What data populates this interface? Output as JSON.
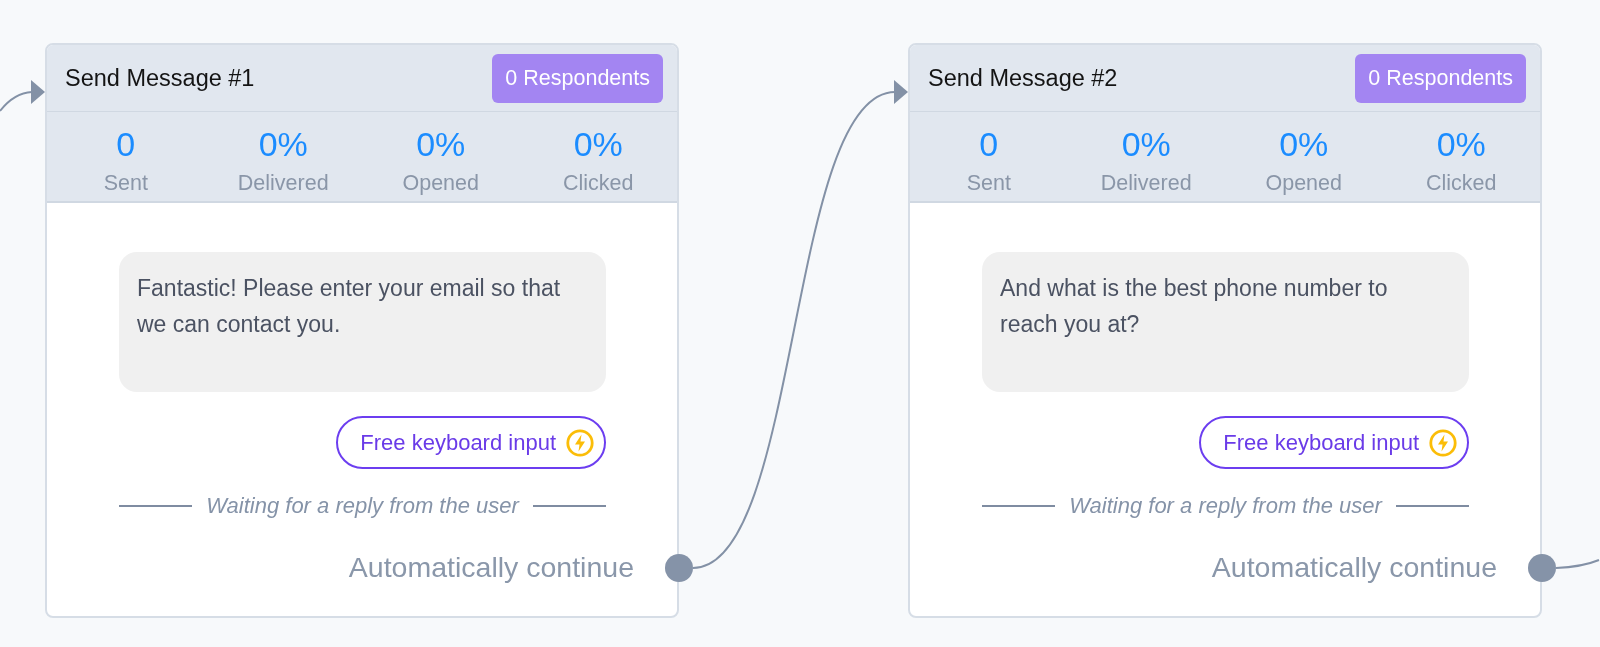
{
  "cards": [
    {
      "title": "Send Message #1",
      "respondents": "0 Respondents",
      "stats": [
        {
          "value": "0",
          "label": "Sent"
        },
        {
          "value": "0%",
          "label": "Delivered"
        },
        {
          "value": "0%",
          "label": "Opened"
        },
        {
          "value": "0%",
          "label": "Clicked"
        }
      ],
      "message": "Fantastic! Please enter your email so that we can contact you.",
      "input_type": "Free keyboard input",
      "waiting_text": "Waiting for a reply from the user",
      "continue_label": "Automatically continue"
    },
    {
      "title": "Send Message #2",
      "respondents": "0 Respondents",
      "stats": [
        {
          "value": "0",
          "label": "Sent"
        },
        {
          "value": "0%",
          "label": "Delivered"
        },
        {
          "value": "0%",
          "label": "Opened"
        },
        {
          "value": "0%",
          "label": "Clicked"
        }
      ],
      "message": "And what is the best phone number to reach you at?",
      "input_type": "Free keyboard input",
      "waiting_text": "Waiting for a reply from the user",
      "continue_label": "Automatically continue"
    }
  ]
}
